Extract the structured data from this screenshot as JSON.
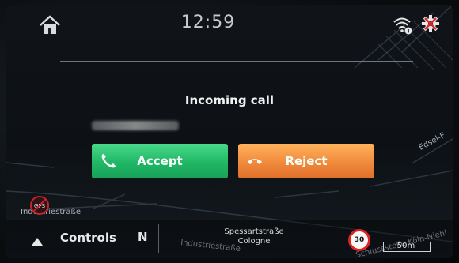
{
  "status_bar": {
    "time": "12:59",
    "icons": [
      "home-icon",
      "wifi-icon",
      "gear-icon"
    ]
  },
  "call": {
    "title": "Incoming call",
    "accept_label": "Accept",
    "reject_label": "Reject",
    "accept_color": "#20b765",
    "reject_color": "#f08a3c"
  },
  "map": {
    "street_labels": [
      "Industriestraße",
      "Edsel-F",
      "Industriestraße",
      "Schlussstelle Köln-Niehl"
    ]
  },
  "bottom_bar": {
    "controls_label": "Controls",
    "heading": "N",
    "street_name": "Spessartstraße",
    "city": "Cologne",
    "speed_limit": "30",
    "scale": "50m"
  }
}
